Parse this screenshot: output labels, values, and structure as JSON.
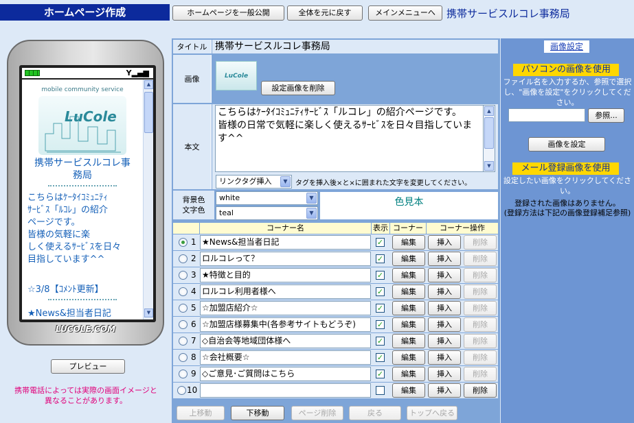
{
  "header": {
    "title": "ホームページ作成",
    "publish_button": "ホームページを一般公開",
    "reset_button": "全体を元に戻す",
    "main_menu_button": "メインメニューへ",
    "site_name": "携帯サービスルコレ事務局"
  },
  "phone": {
    "service_text": "mobile community service",
    "logo_text": "LuCole",
    "title_line1": "携帯サービスルコレ事",
    "title_line2": "務局",
    "body_lines": [
      "こちらはｹｰﾀｲｺﾐｭﾆﾃｨ",
      "ｻｰﾋﾞｽ「ﾙｺﾚ」の紹介",
      "ページです。",
      "皆様の気軽に楽",
      "しく使えるｻｰﾋﾞｽを日々",
      "目指しています^^"
    ],
    "comment_line": "☆3/8【ｺﾒﾝﾄ更新】",
    "news_line": "★News&担当者日記",
    "brand": "LUCOLE.COM"
  },
  "left": {
    "preview_button": "プレビュー",
    "note_line1": "携帯電話によっては実際の画面イメージと",
    "note_line2": "異なることがあります。"
  },
  "form": {
    "title_label": "タイトル",
    "title_value": "携帯サービスルコレ事務局",
    "image_label": "画像",
    "delete_image_button": "設定画像を削除",
    "body_label": "本文",
    "body_text": "こちらはｹｰﾀｲｺﾐｭﾆﾃｨｻｰﾋﾞｽ「ルコレ」の紹介ページです。\n皆様の日常で気軽に楽しく使えるｻｰﾋﾞｽを日々目指しています^^",
    "link_tag_select": "リンクタグ挿入",
    "link_tag_hint": "タグを挿入後×と×に囲まれた文字を変更してください。",
    "bg_color_label": "背景色",
    "text_color_label": "文字色",
    "bg_color_value": "white",
    "text_color_value": "teal",
    "color_sample": "色見本"
  },
  "corner_table": {
    "headers": [
      "コーナー名",
      "表示",
      "コーナー",
      "コーナー操作"
    ],
    "edit_label": "編集",
    "insert_label": "挿入",
    "delete_label": "削除",
    "rows": [
      {
        "num": "1",
        "name": "★News&担当者日記"
      },
      {
        "num": "2",
        "name": "ロルコレって？"
      },
      {
        "num": "3",
        "name": "★特徴と目的"
      },
      {
        "num": "4",
        "name": "ロルコレ利用者様へ"
      },
      {
        "num": "5",
        "name": "☆加盟店紹介☆"
      },
      {
        "num": "6",
        "name": "☆加盟店様募集中(各参考サイトもどうぞ)"
      },
      {
        "num": "7",
        "name": "◇自治会等地域団体様へ"
      },
      {
        "num": "8",
        "name": "☆会社概要☆"
      },
      {
        "num": "9",
        "name": "◇ご意見･ご質問はこちら"
      },
      {
        "num": "10",
        "name": ""
      }
    ]
  },
  "bottom_nav": {
    "up": "上移動",
    "down": "下移動",
    "page_delete": "ページ削除",
    "back": "戻る",
    "top": "トップへ戻る"
  },
  "right": {
    "image_settings": "画像設定",
    "pc_image_heading": "パソコンの画像を使用",
    "pc_image_desc": "ファイル名を入力するか、参照で選択し、\"画像を設定\"をクリックしてください。",
    "browse_button": "参照...",
    "set_image_button": "画像を設定",
    "mail_image_heading": "メール登録画像を使用",
    "mail_image_desc": "設定したい画像をクリックしてください。",
    "no_images": "登録された画像はありません。",
    "registration_note": "(登録方法は下記の画像登録補足参照)"
  },
  "colors": {
    "header_bg": "#0c2a9c",
    "accent": "#1560b8",
    "panel": "#7ea5d8",
    "note_red": "#e0007a"
  }
}
